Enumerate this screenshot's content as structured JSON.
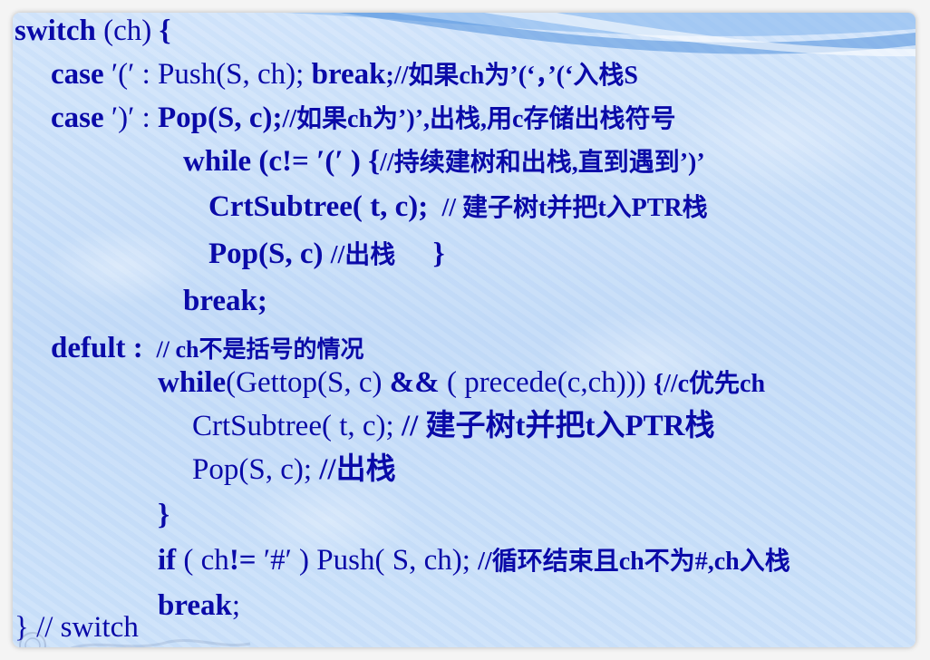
{
  "code": {
    "l1_kw": "switch",
    "l1_rest": " (ch) ",
    "l1_brace": "{",
    "l2_kw": "case",
    "l2_lit": " ′(′ : ",
    "l2_call": "Push(S, ch); ",
    "l2_break": "break",
    "l2_comment": ";//如果ch为’(‘，’(‘入栈S",
    "l3_kw": "case",
    "l3_lit": " ′)′ : ",
    "l3_call": "Pop(S, c);",
    "l3_comment": "//如果ch为’)’,出栈,用c存储出栈符号",
    "l4_code": "while (c!= ′(′ ) {",
    "l4_comment": "//持续建树和出栈,直到遇到’)’",
    "l5_code": "CrtSubtree( t, c); ",
    "l5_comment": " // 建子树t并把t入PTR栈",
    "l6_code": "Pop(S, c) ",
    "l6_comment": "//出栈",
    "l6_brace": "     }",
    "l7_break": "break;",
    "l8_kw": "defult : ",
    "l8_comment": " // ch不是括号的情况",
    "l9_kw": "while",
    "l9_mid": "(Gettop(S, c) ",
    "l9_and": "&&",
    "l9_rest": " ( precede(c,ch))) ",
    "l9_comment": "{//c优先ch",
    "l10_code": "CrtSubtree( t, c); ",
    "l10_comment": "// 建子树t并把t入PTR栈",
    "l11_code": "Pop(S, c); ",
    "l11_comment": "//出栈",
    "l12_brace": "}",
    "l13_kw": "if",
    "l13_mid": " ( ch",
    "l13_ne": "!=",
    "l13_rest": " ′#′ ) Push( S, ch); ",
    "l13_comment": "//循环结束且ch不为#,ch入栈",
    "l14_break": "break",
    "l14_semi": ";",
    "l15_code": "} // switch"
  },
  "colors": {
    "code_text": "#0a0aa8",
    "background": "#c9dff9",
    "swoosh": "#5b9be0"
  }
}
